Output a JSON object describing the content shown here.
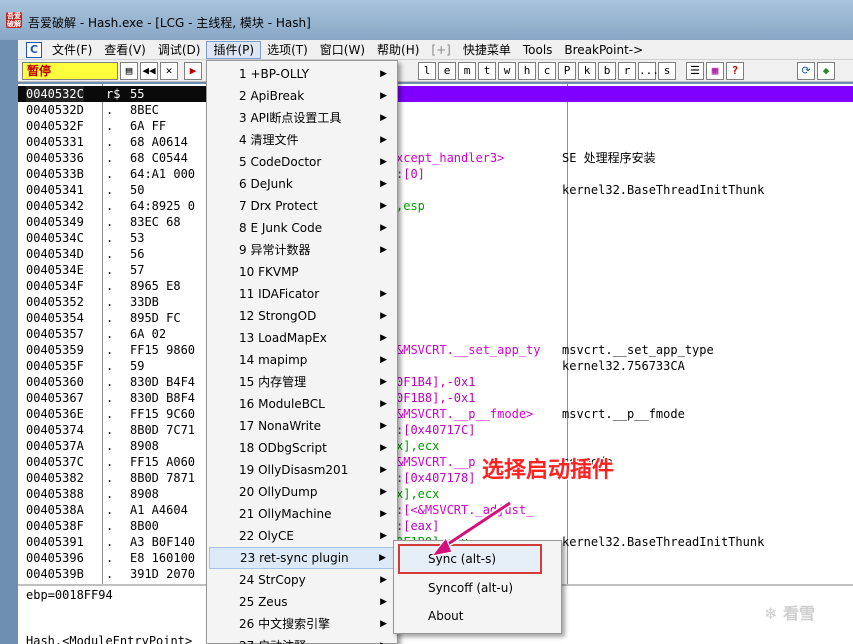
{
  "window": {
    "title": "吾爱破解 - Hash.exe - [LCG - 主线程, 模块 - Hash]",
    "icon_text": "吾爱破解"
  },
  "menubar": {
    "mdi_icon": "C",
    "items": [
      "文件(F)",
      "查看(V)",
      "调试(D)",
      "插件(P)",
      "选项(T)",
      "窗口(W)",
      "帮助(H)",
      "[+]",
      "快捷菜单",
      "Tools",
      "BreakPoint->"
    ]
  },
  "toolbar": {
    "status": "暂停",
    "letters": [
      "l",
      "e",
      "m",
      "t",
      "w",
      "h",
      "c",
      "P",
      "k",
      "b",
      "r",
      "...",
      "s"
    ]
  },
  "disasm": {
    "rows": [
      {
        "addr": "0040532C",
        "mark": "r$",
        "hex": "55",
        "asm": "",
        "cmt": ""
      },
      {
        "addr": "0040532D",
        "mark": ".",
        "hex": "8BEC",
        "asm": "",
        "cmt": ""
      },
      {
        "addr": "0040532F",
        "mark": ".",
        "hex": "6A FF",
        "asm": "",
        "cmt": ""
      },
      {
        "addr": "00405331",
        "mark": ".",
        "hex": "68 A0614",
        "asm": "",
        "cmt": ""
      },
      {
        "addr": "00405336",
        "mark": ".",
        "hex": "68 C0544",
        "asm": "xcept_handler3>",
        "cmt": "SE 处理程序安装"
      },
      {
        "addr": "0040533B",
        "mark": ".",
        "hex": "64:A1 000",
        "asm": ":[0]",
        "cmt": ""
      },
      {
        "addr": "00405341",
        "mark": ".",
        "hex": "50",
        "asm": "",
        "cmt": "kernel32.BaseThreadInitThunk"
      },
      {
        "addr": "00405342",
        "mark": ".",
        "hex": "64:8925 0",
        "asm": ",esp",
        "cmt": ""
      },
      {
        "addr": "00405349",
        "mark": ".",
        "hex": "83EC 68",
        "asm": "",
        "cmt": ""
      },
      {
        "addr": "0040534C",
        "mark": ".",
        "hex": "53",
        "asm": "",
        "cmt": ""
      },
      {
        "addr": "0040534D",
        "mark": ".",
        "hex": "56",
        "asm": "",
        "cmt": ""
      },
      {
        "addr": "0040534E",
        "mark": ".",
        "hex": "57",
        "asm": "",
        "cmt": ""
      },
      {
        "addr": "0040534F",
        "mark": ".",
        "hex": "8965 E8",
        "asm": "",
        "cmt": ""
      },
      {
        "addr": "00405352",
        "mark": ".",
        "hex": "33DB",
        "asm": "",
        "cmt": ""
      },
      {
        "addr": "00405354",
        "mark": ".",
        "hex": "895D FC",
        "asm": "",
        "cmt": ""
      },
      {
        "addr": "00405357",
        "mark": ".",
        "hex": "6A 02",
        "asm": "",
        "cmt": ""
      },
      {
        "addr": "00405359",
        "mark": ".",
        "hex": "FF15 9860",
        "asm": "&MSVCRT.__set_app_ty",
        "cmt": "msvcrt.__set_app_type"
      },
      {
        "addr": "0040535F",
        "mark": ".",
        "hex": "59",
        "asm": "",
        "cmt": "kernel32.756733CA"
      },
      {
        "addr": "00405360",
        "mark": ".",
        "hex": "830D B4F4",
        "asm": "0F1B4],-0x1",
        "cmt": ""
      },
      {
        "addr": "00405367",
        "mark": ".",
        "hex": "830D B8F4",
        "asm": "0F1B8],-0x1",
        "cmt": ""
      },
      {
        "addr": "0040536E",
        "mark": ".",
        "hex": "FF15 9C60",
        "asm": "&MSVCRT.__p__fmode>",
        "cmt": "msvcrt.__p__fmode"
      },
      {
        "addr": "00405374",
        "mark": ".",
        "hex": "8B0D 7C71",
        "asm": ":[0x40717C]",
        "cmt": ""
      },
      {
        "addr": "0040537A",
        "mark": ".",
        "hex": "8908",
        "asm": "x],ecx",
        "cmt": ""
      },
      {
        "addr": "0040537C",
        "mark": ".",
        "hex": "FF15 A060",
        "asm": "&MSVCRT.__p",
        "cmt": "commode"
      },
      {
        "addr": "00405382",
        "mark": ".",
        "hex": "8B0D 7871",
        "asm": ":[0x407178]",
        "cmt": ""
      },
      {
        "addr": "00405388",
        "mark": ".",
        "hex": "8908",
        "asm": "x],ecx",
        "cmt": ""
      },
      {
        "addr": "0040538A",
        "mark": ".",
        "hex": "A1 A4604",
        "asm": ":[<&MSVCRT._adjust_",
        "cmt": ""
      },
      {
        "addr": "0040538F",
        "mark": ".",
        "hex": "8B00",
        "asm": ":[eax]",
        "cmt": ""
      },
      {
        "addr": "00405391",
        "mark": ".",
        "hex": "A3 B0F140",
        "asm": "0F1B0],eax",
        "cmt": "kernel32.BaseThreadInitThunk"
      },
      {
        "addr": "00405396",
        "mark": ".",
        "hex": "E8 160100",
        "asm": "",
        "cmt": ""
      },
      {
        "addr": "0040539B",
        "mark": ".",
        "hex": "391D 2070",
        "asm": "",
        "cmt": ""
      }
    ]
  },
  "info": {
    "line1": "ebp=0018FF94",
    "line2": "Hash.<ModuleEntryPoint>"
  },
  "plugin_menu": {
    "items": [
      "1 +BP-OLLY",
      "2 ApiBreak",
      "3 API断点设置工具",
      "4 清理文件",
      "5 CodeDoctor",
      "6 DeJunk",
      "7 Drx Protect",
      "8 E Junk Code",
      "9 异常计数器",
      "10 FKVMP",
      "11 IDAFicator",
      "12 StrongOD",
      "13 LoadMapEx",
      "14 mapimp",
      "15 内存管理",
      "16 ModuleBCL",
      "17 NonaWrite",
      "18 ODbgScript",
      "19 OllyDisasm201",
      "20 OllyDump",
      "21 OllyMachine",
      "22 OlyCE",
      "23 ret-sync plugin",
      "24 StrCopy",
      "25 Zeus",
      "26 中文搜索引擎",
      "27 启动注释"
    ],
    "has_submenu": [
      true,
      true,
      true,
      true,
      true,
      true,
      true,
      true,
      true,
      false,
      true,
      true,
      true,
      true,
      true,
      true,
      true,
      true,
      true,
      true,
      true,
      true,
      true,
      true,
      true,
      true,
      true
    ],
    "highlighted_index": 22
  },
  "submenu": {
    "items": [
      "Sync (alt-s)",
      "Syncoff (alt-u)",
      "About"
    ]
  },
  "annotation": "选择启动插件",
  "watermark": "看雪",
  "colors": {
    "status_bg": "#ffff3b",
    "annotation": "#ff2020",
    "highlight_box": "#d43a3a"
  }
}
